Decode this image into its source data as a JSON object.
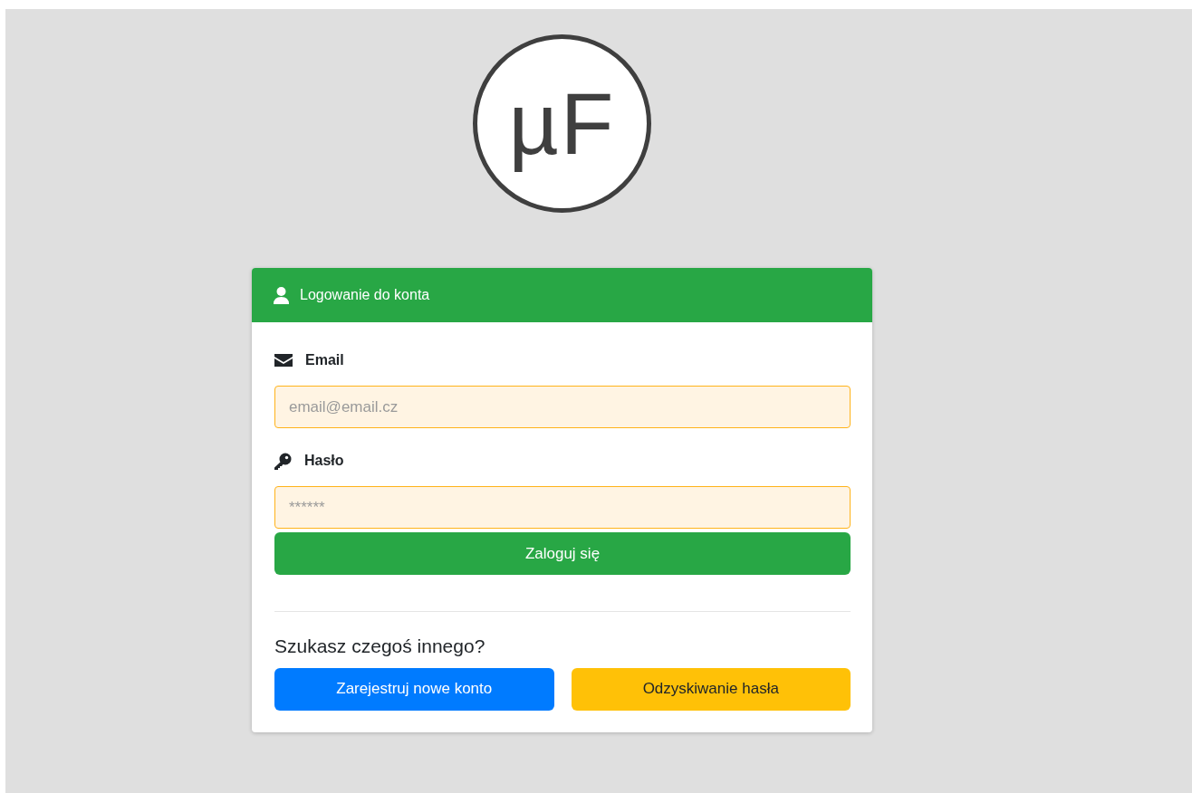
{
  "logo": {
    "text": "µF"
  },
  "card": {
    "title": "Logowanie do konta",
    "fields": [
      {
        "kind": "email",
        "label": "Email",
        "placeholder": "email@email.cz"
      },
      {
        "kind": "password",
        "label": "Hasło",
        "placeholder": "******"
      }
    ],
    "submit": {
      "label": "Zaloguj się"
    },
    "other_heading": "Szukasz czegoś innego?",
    "buttons": [
      {
        "label": "Zarejestruj nowe konto",
        "kind": "primary"
      },
      {
        "label": "Odzyskiwanie hasła",
        "kind": "warning"
      }
    ]
  }
}
